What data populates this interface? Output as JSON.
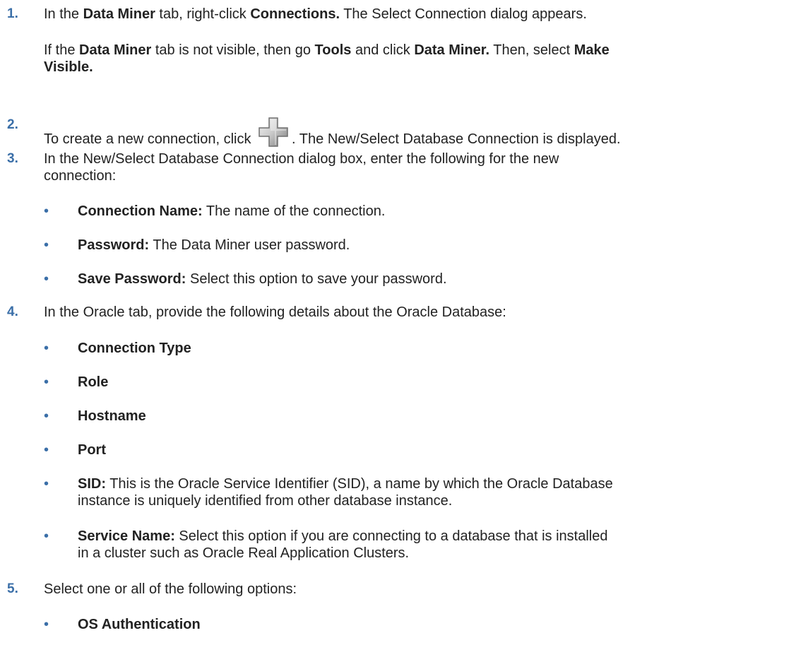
{
  "icons": {
    "new_connection": "plus-cross-icon"
  },
  "step1": {
    "num": "1.",
    "p1": "In the ",
    "p1_b1": "Data Miner",
    "p1_t2": " tab, right-click ",
    "p1_b2": "Connections.",
    "p1_t3": " The Select Connection dialog appears.",
    "p2_t1": "If the ",
    "p2_b1": "Data Miner",
    "p2_t2": " tab is not visible, then go ",
    "p2_b2": "Tools",
    "p2_t3": " and click ",
    "p2_b3": "Data Miner.",
    "p2_t4": " Then, select ",
    "p2_b4": "Make",
    "p2_b5": "Visible."
  },
  "step2": {
    "num": "2.",
    "t1": "To create a new connection, click ",
    "t2": ". The New/Select Database Connection is displayed."
  },
  "step3": {
    "num": "3.",
    "line1": "In the New/Select Database Connection dialog box, enter the following for the new",
    "line2": "connection:",
    "bullets": [
      {
        "label": "Connection Name:",
        "text": " The name of the connection."
      },
      {
        "label": "Password:",
        "text": " The Data Miner user password."
      },
      {
        "label": "Save Password:",
        "text": " Select this option to save your password."
      }
    ]
  },
  "step4": {
    "num": "4.",
    "text": "In the Oracle tab, provide the following details about the Oracle Database:",
    "bullets": [
      {
        "label": "Connection Type",
        "text": ""
      },
      {
        "label": "Role",
        "text": ""
      },
      {
        "label": "Hostname",
        "text": ""
      },
      {
        "label": "Port",
        "text": ""
      },
      {
        "label": "SID:",
        "text": " This is the Oracle Service Identifier (SID), a name by which the Oracle Database",
        "text2": "instance is uniquely identified from other database instance."
      },
      {
        "label": "Service Name:",
        "text": " Select this option if you are connecting to a database that is installed",
        "text2": "in a cluster such as Oracle Real Application Clusters."
      }
    ]
  },
  "step5": {
    "num": "5.",
    "text": "Select one or all of the following options:",
    "bullets": [
      {
        "label": "OS Authentication",
        "text": ""
      }
    ]
  },
  "bullet_char": "•",
  "colors": {
    "accent": "#3b6fa8",
    "text": "#222222"
  }
}
